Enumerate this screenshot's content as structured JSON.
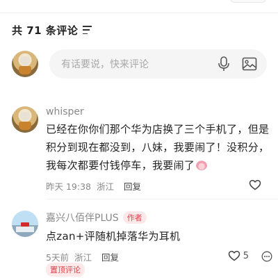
{
  "header": {
    "comment_count_label": "共 71 条评论",
    "sort_icon": "sort-lines-icon"
  },
  "composer": {
    "placeholder": "有话要说，快来评论",
    "mic_icon": "microphone-icon",
    "image_icon": "image-icon"
  },
  "comments": [
    {
      "author": "whisper",
      "text": "已经在你你们那个华为店换了三个手机了，但是积分到现在都没到，八妹，我要闹了！没积分，我每次都要付钱停车，我要闹了",
      "emoji": "emoji-icon",
      "time": "昨天 19:38",
      "location": "浙江",
      "reply_label": "回复",
      "like_icon": "heart-outline-icon",
      "like_count": ""
    },
    {
      "author": "嘉兴八佰伴PLUS",
      "author_badge": "作者",
      "text": "点zan+评随机掉落华为耳机",
      "time": "5天前",
      "location": "浙江",
      "reply_label": "回复",
      "like_icon": "heart-outline-icon",
      "like_count": "5",
      "more_icon": "more-circle-icon",
      "pinned_label": "置顶评论"
    }
  ],
  "colors": {
    "accent_red": "#e0424b",
    "badge_bg": "#fde9ea",
    "input_bg": "#f5f5f5",
    "muted_text": "#888888"
  }
}
